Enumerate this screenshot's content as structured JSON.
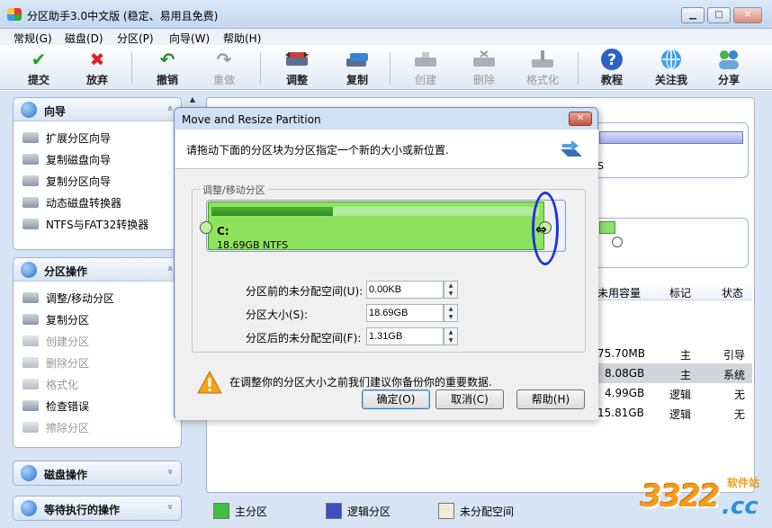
{
  "window": {
    "title": "分区助手3.0中文版 (稳定、易用且免费)",
    "min": "▁",
    "max": "□",
    "close": "✕"
  },
  "menu": [
    "常规(G)",
    "磁盘(D)",
    "分区(P)",
    "向导(W)",
    "帮助(H)"
  ],
  "toolbar": [
    {
      "label": "提交",
      "icon": "check-icon",
      "enabled": true
    },
    {
      "label": "放弃",
      "icon": "x-icon",
      "enabled": true
    },
    {
      "label": "撤销",
      "icon": "undo-icon",
      "enabled": true
    },
    {
      "label": "重做",
      "icon": "redo-icon",
      "enabled": false
    },
    {
      "label": "调整",
      "icon": "resize-partition-icon",
      "enabled": true
    },
    {
      "label": "复制",
      "icon": "copy-partition-icon",
      "enabled": true
    },
    {
      "label": "创建",
      "icon": "create-partition-icon",
      "enabled": false
    },
    {
      "label": "删除",
      "icon": "delete-partition-icon",
      "enabled": false
    },
    {
      "label": "格式化",
      "icon": "format-icon",
      "enabled": false
    },
    {
      "label": "教程",
      "icon": "help-icon",
      "enabled": true
    },
    {
      "label": "关注我",
      "icon": "globe-icon",
      "enabled": true
    },
    {
      "label": "分享",
      "icon": "share-icon",
      "enabled": true
    }
  ],
  "sidebar": {
    "wizard": {
      "title": "向导",
      "chevron": "«",
      "items": [
        "扩展分区向导",
        "复制磁盘向导",
        "复制分区向导",
        "动态磁盘转换器",
        "NTFS与FAT32转换器"
      ]
    },
    "partition_ops": {
      "title": "分区操作",
      "chevron": "«",
      "items": [
        {
          "label": "调整/移动分区",
          "enabled": true
        },
        {
          "label": "复制分区",
          "enabled": true
        },
        {
          "label": "创建分区",
          "enabled": false
        },
        {
          "label": "删除分区",
          "enabled": false
        },
        {
          "label": "格式化",
          "enabled": false
        },
        {
          "label": "检查错误",
          "enabled": true
        },
        {
          "label": "擦除分区",
          "enabled": false
        }
      ]
    },
    "disk_ops": {
      "title": "磁盘操作",
      "chevron": "»"
    },
    "pending_ops": {
      "title": "等待执行的操作",
      "chevron": "»"
    }
  },
  "disk_map": {
    "disk1_fs": "S"
  },
  "table": {
    "headers": [
      "未用容量",
      "标记",
      "状态"
    ],
    "rows": [
      {
        "free": "75.70MB",
        "flag": "主",
        "status": "引导",
        "selected": false
      },
      {
        "free": "8.08GB",
        "flag": "主",
        "status": "系统",
        "selected": true
      },
      {
        "free": "4.99GB",
        "flag": "逻辑",
        "status": "无",
        "selected": false
      },
      {
        "free": "15.81GB",
        "flag": "逻辑",
        "status": "无",
        "selected": false
      }
    ]
  },
  "legend": [
    {
      "label": "主分区",
      "color": "#3fbf3f"
    },
    {
      "label": "逻辑分区",
      "color": "#3b4fc4"
    },
    {
      "label": "未分配空间",
      "color": "#f2eadb"
    }
  ],
  "watermark": {
    "number": "3322",
    "site": "软件站",
    "tld": ".cc"
  },
  "dialog": {
    "title": "Move and Resize Partition",
    "close": "✕",
    "instruction": "请拖动下面的分区块为分区指定一个新的大小或新位置.",
    "group_title": "调整/移动分区",
    "partition": {
      "name": "C:",
      "size_fs": "18.69GB NTFS",
      "used_fraction": 0.37
    },
    "resize_cursor": "⇔",
    "fields": [
      {
        "label": "分区前的未分配空间(U):",
        "value": "0.00KB"
      },
      {
        "label": "分区大小(S):",
        "value": "18.69GB"
      },
      {
        "label": "分区后的未分配空间(F):",
        "value": "1.31GB"
      }
    ],
    "warning": "在调整你的分区大小之前我们建议你备份你的重要数据.",
    "buttons": {
      "ok": "确定(O)",
      "cancel": "取消(C)",
      "help": "帮助(H)"
    }
  }
}
